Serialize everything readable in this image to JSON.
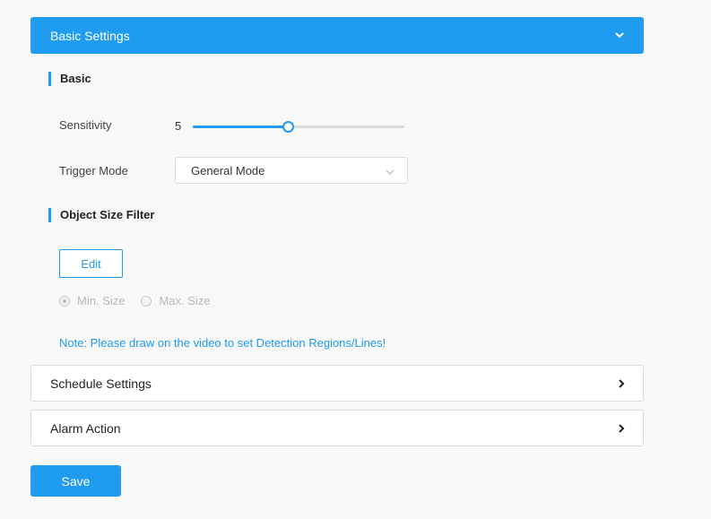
{
  "basic_settings": {
    "title": "Basic Settings",
    "toggle_icon": "chevron-down-icon"
  },
  "basic": {
    "title": "Basic",
    "sensitivity_label": "Sensitivity",
    "sensitivity_value": "5",
    "sensitivity_fraction": 0.45,
    "trigger_mode_label": "Trigger Mode",
    "trigger_mode_value": "General Mode"
  },
  "object_size_filter": {
    "title": "Object Size Filter",
    "edit_label": "Edit",
    "min_size_label": "Min. Size",
    "max_size_label": "Max. Size",
    "selected": "Min. Size"
  },
  "note": "Note: Please draw on the video to set Detection Regions/Lines!",
  "schedule_settings": {
    "title": "Schedule Settings",
    "toggle_icon": "chevron-right-icon"
  },
  "alarm_action": {
    "title": "Alarm Action",
    "toggle_icon": "chevron-right-icon"
  },
  "save_label": "Save",
  "colors": {
    "accent": "#1f9bf0",
    "background": "#f8f8f8",
    "disabled": "#b8b8b8"
  }
}
